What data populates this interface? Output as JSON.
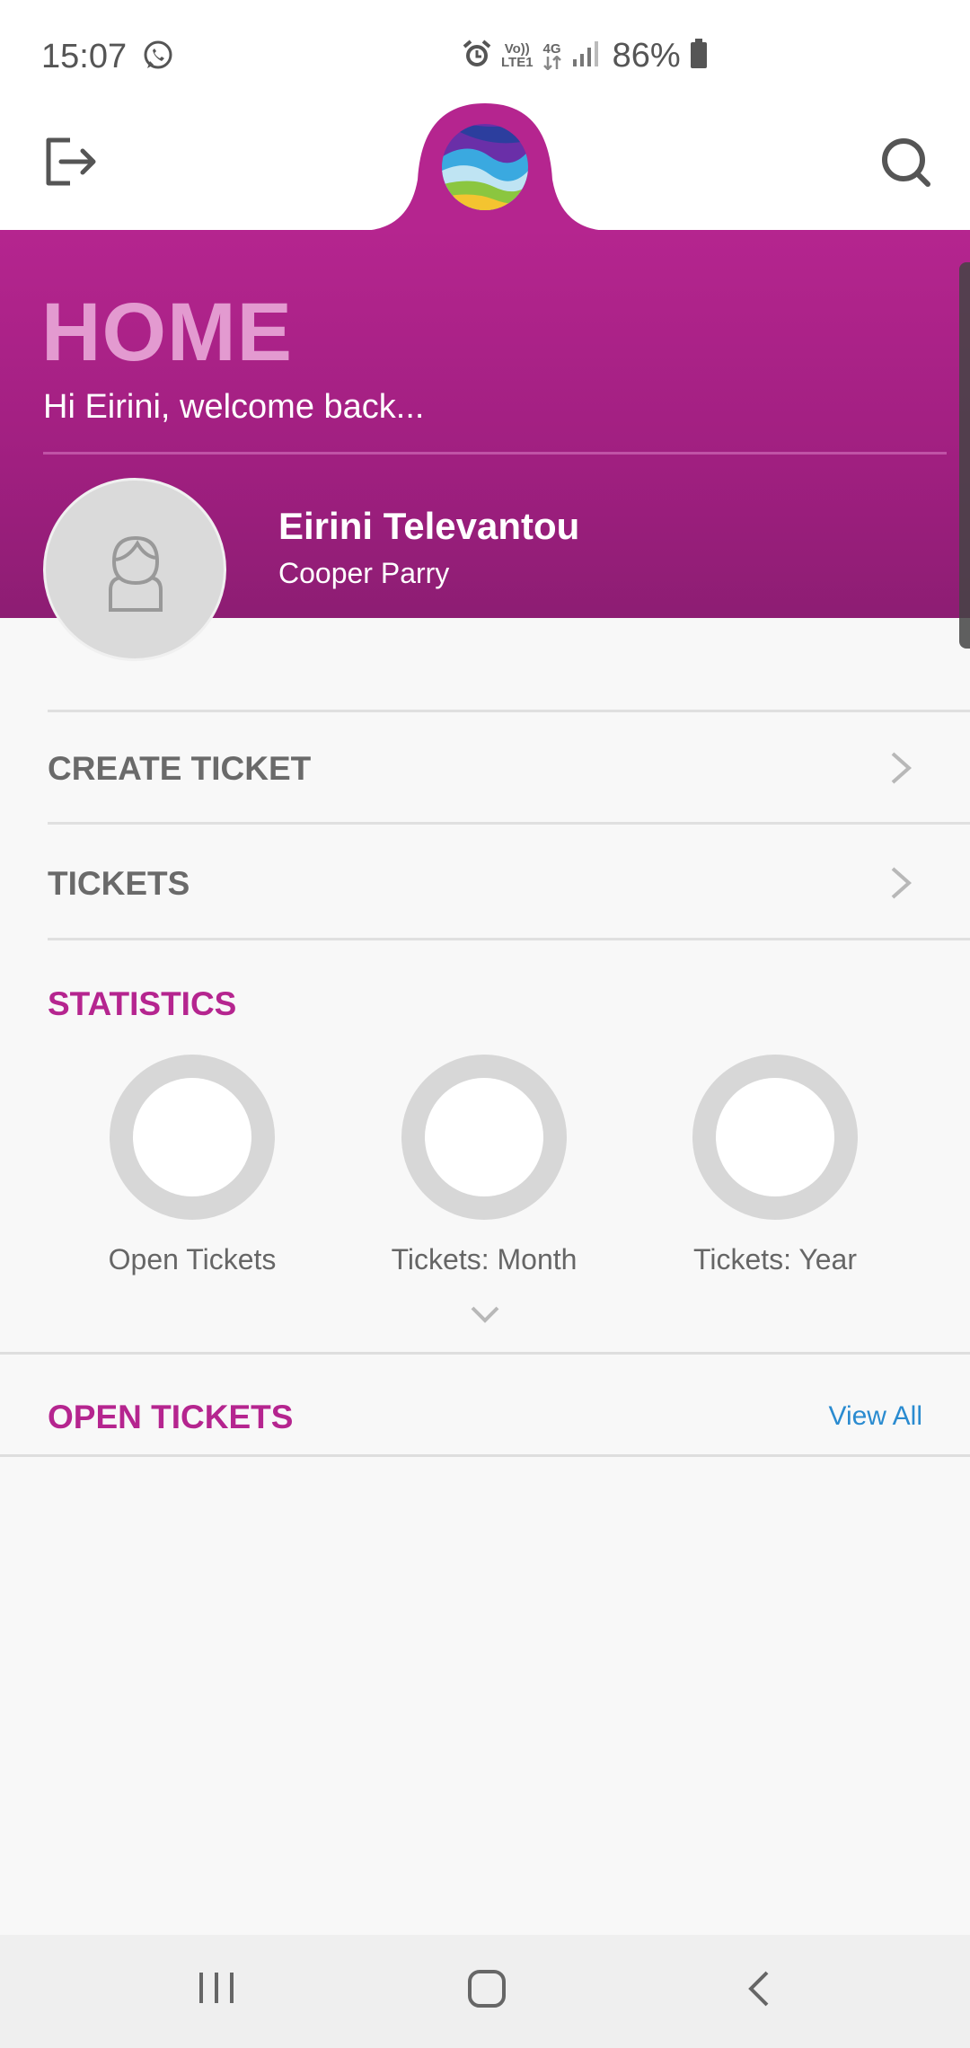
{
  "status_bar": {
    "time": "15:07",
    "network_top": "Vo))",
    "network_bottom": "LTE1",
    "network_type": "4G",
    "battery": "86%"
  },
  "header": {
    "logout_icon": "logout-icon",
    "search_icon": "search-icon",
    "logo_icon": "app-logo"
  },
  "banner": {
    "title": "HOME",
    "welcome": "Hi Eirini, welcome back...",
    "user_name": "Eirini Televantou",
    "company": "Cooper Parry"
  },
  "menu": {
    "items": [
      {
        "label": "CREATE TICKET"
      },
      {
        "label": "TICKETS"
      }
    ]
  },
  "statistics": {
    "title": "STATISTICS",
    "items": [
      {
        "label": "Open Tickets"
      },
      {
        "label": "Tickets: Month"
      },
      {
        "label": "Tickets: Year"
      }
    ]
  },
  "open_tickets": {
    "title": "OPEN TICKETS",
    "view_all": "View All"
  },
  "colors": {
    "brand": "#b5258f",
    "link": "#2a8bd0"
  }
}
